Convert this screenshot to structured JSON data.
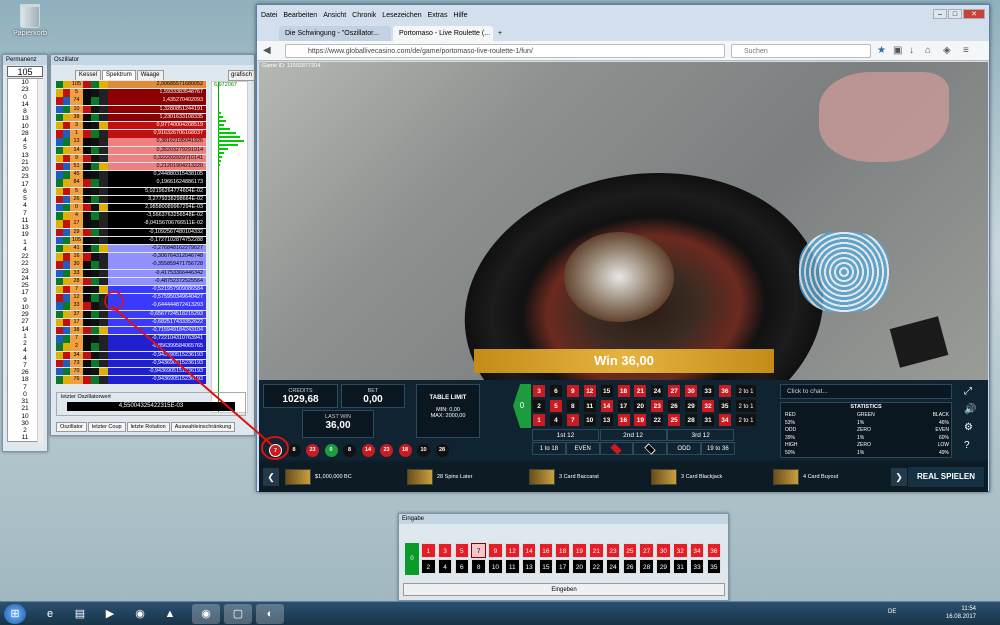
{
  "desktop": {
    "recycle_label": "Papierkorb"
  },
  "permanenz": {
    "title": "Permanenz",
    "input": "105",
    "numbers": [
      "10",
      "23",
      "0",
      "14",
      "8",
      "13",
      "10",
      "28",
      "4",
      "5",
      "13",
      "21",
      "20",
      "23",
      "17",
      "6",
      "5",
      "4",
      "7",
      "11",
      "13",
      "19",
      "1",
      "4",
      "22",
      "22",
      "23",
      "24",
      "25",
      "17",
      "9",
      "10",
      "29",
      "27",
      "14",
      "1",
      "2",
      "4",
      "4",
      "7",
      "26",
      "18",
      "7",
      "0",
      "31",
      "21",
      "10",
      "30",
      "2",
      "11"
    ]
  },
  "oszillator": {
    "title": "Oszillator",
    "tabs": [
      "Kessel",
      "Spektrum",
      "Waage"
    ],
    "tabs_right": [
      "grafisch",
      "Textform"
    ],
    "graph_label": "6,972067",
    "rows": [
      {
        "n": "105",
        "v": "2,00685571680052",
        "c": "#e08a3a"
      },
      {
        "n": "5",
        "v": "1,5933383548767",
        "c": "#8b0000"
      },
      {
        "n": "74",
        "v": "1,435270402093",
        "c": "#8b0000"
      },
      {
        "n": "10",
        "v": "1,3280851244191",
        "c": "#8b0000"
      },
      {
        "n": "38",
        "v": "1,2301633108335",
        "c": "#8b0000"
      },
      {
        "n": "3",
        "v": "0,97740004208519",
        "c": "#c01010"
      },
      {
        "n": "1",
        "v": "0,916326706168037",
        "c": "#c01010"
      },
      {
        "n": "13",
        "v": "0,38162195041926",
        "c": "#f08080"
      },
      {
        "n": "14",
        "v": "0,35203279291914",
        "c": "#f08080"
      },
      {
        "n": "9",
        "v": "0,322202929710141",
        "c": "#f08080"
      },
      {
        "n": "51",
        "v": "0,21201904213220",
        "c": "#f08080"
      },
      {
        "n": "45",
        "v": "0,244880315438105",
        "c": "#000"
      },
      {
        "n": "84",
        "v": "0,19661624886173",
        "c": "#000"
      },
      {
        "n": "5",
        "v": "5,02196264774604E-02",
        "c": "#000"
      },
      {
        "n": "26",
        "v": "3,2779238298664E-02",
        "c": "#000"
      },
      {
        "n": "0",
        "v": "2,98580089967294E-03",
        "c": "#000"
      },
      {
        "n": "4",
        "v": "-3,5663763256548E-02",
        "c": "#000"
      },
      {
        "n": "17",
        "v": "-8,04156706766511E-02",
        "c": "#000"
      },
      {
        "n": "29",
        "v": "-0,1092567480104332",
        "c": "#000"
      },
      {
        "n": "105",
        "v": "-0,1727102874752288",
        "c": "#000"
      },
      {
        "n": "41",
        "v": "-0,276848162279027",
        "c": "#9090ff"
      },
      {
        "n": "16",
        "v": "-0,306764312046748",
        "c": "#9090ff"
      },
      {
        "n": "30",
        "v": "-0,355859471756728",
        "c": "#9090ff"
      },
      {
        "n": "33",
        "v": "-0,41753366446342",
        "c": "#9090ff"
      },
      {
        "n": "28",
        "v": "-0,48752372525564",
        "c": "#9090ff"
      },
      {
        "n": "7",
        "v": "-0,521957909086584",
        "c": "#3a3aff"
      },
      {
        "n": "12",
        "v": "-0,575950349640427",
        "c": "#3a3aff"
      },
      {
        "n": "33",
        "v": "-0,644444872413293",
        "c": "#3a3aff"
      },
      {
        "n": "37",
        "v": "-0,6567724518215293",
        "c": "#3a3aff"
      },
      {
        "n": "17",
        "v": "-0,682517433352622",
        "c": "#3a3aff"
      },
      {
        "n": "38",
        "v": "-0,715949184243104",
        "c": "#3a3aff"
      },
      {
        "n": "7",
        "v": "-0,722104310763941",
        "c": "#2020d0"
      },
      {
        "n": "2",
        "v": "-0,856399584065765",
        "c": "#2020d0"
      },
      {
        "n": "34",
        "v": "-0,943690515236193",
        "c": "#2020d0"
      },
      {
        "n": "73",
        "v": "-0,943690515236193",
        "c": "#2020d0"
      },
      {
        "n": "70",
        "v": "-0,9436905151236193",
        "c": "#2020d0"
      },
      {
        "n": "76",
        "v": "-0,943690515236193",
        "c": "#2020d0"
      }
    ],
    "last_label": "letzter Oszillatorwert",
    "last_value": "4,55004325422315E-03",
    "bottom_tabs": [
      "Oszillator",
      "letzter Coup",
      "letzte Rotation",
      "Auswahleinschränkung"
    ]
  },
  "browser": {
    "menu": [
      "Datei",
      "Bearbeiten",
      "Ansicht",
      "Chronik",
      "Lesezeichen",
      "Extras",
      "Hilfe"
    ],
    "tab1": "Die Schwingung - \"Oszillator...",
    "tab2": "Portomaso - Live Roulette (...",
    "url": "https://www.globallivecasino.com/de/game/portomaso-live-roulette-1/fun/",
    "search_placeholder": "Suchen"
  },
  "game": {
    "game_id": "Game ID: 11502877204",
    "win": "Win 36,00",
    "credits_label": "CREDITS",
    "credits": "1029,68",
    "bet_label": "BET",
    "bet": "0,00",
    "lastwin_label": "LAST WIN",
    "lastwin": "36,00",
    "table_limit": "TABLE LIMIT",
    "min": "MIN: 0,00",
    "max": "MAX: 2000,00",
    "zero": "0",
    "dozens": [
      "1st 12",
      "2nd 12",
      "3rd 12"
    ],
    "column_label": "2 to 1",
    "evens": [
      "1 to 18",
      "EVEN",
      "",
      "",
      "ODD",
      "19 to 36"
    ],
    "chat_placeholder": "Click to chat...",
    "stats": {
      "title": "STATISTICS",
      "rows": [
        {
          "l": "RED",
          "m": "GREEN",
          "r": "BLACK"
        },
        {
          "l": "53%",
          "m": "1%",
          "r": "46%"
        },
        {
          "l": "ODD",
          "m": "ZERO",
          "r": "EVEN"
        },
        {
          "l": "39%",
          "m": "1%",
          "r": "60%"
        },
        {
          "l": "HIGH",
          "m": "ZERO",
          "r": "LOW"
        },
        {
          "l": "50%",
          "m": "1%",
          "r": "49%"
        }
      ]
    },
    "recent": [
      "7",
      "8",
      "23",
      "0",
      "8",
      "14",
      "23",
      "18",
      "10",
      "28"
    ],
    "games": [
      "$1,000,000 BC",
      "28 Spins Later",
      "3 Card Baccarat",
      "3 Card Blackjack",
      "4 Card Buyout"
    ],
    "real": "REAL SPIELEN"
  },
  "eingabe": {
    "title": "Eingabe",
    "zero": "0",
    "button": "Eingeben",
    "selected": "7"
  },
  "taskbar": {
    "lang": "DE",
    "time": "11:54",
    "date": "16.08.2017"
  },
  "colors": {
    "red": "#c81c22",
    "black": "#111111",
    "green": "#1c9c3c",
    "accent": "#e6b340"
  }
}
